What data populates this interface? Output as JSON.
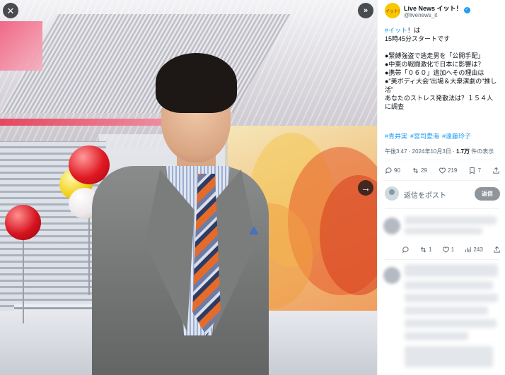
{
  "viewer": {
    "close_icon": "close-icon",
    "expand_icon": "expand-right-icon",
    "next_icon": "arrow-right-icon"
  },
  "tweet": {
    "author_name": "Live News イット！",
    "author_handle": "@livenews_it",
    "avatar_text": "イット!",
    "text_lines": [
      {
        "hashtag": "#イット",
        "rest": "！は"
      },
      {
        "hashtag": "",
        "rest": "15時45分スタートです"
      },
      {
        "hashtag": "",
        "rest": ""
      },
      {
        "hashtag": "",
        "rest": "●緊縛強盗で逃走男を「公開手配」"
      },
      {
        "hashtag": "",
        "rest": "●中東の戦闘激化で日本に影響は？"
      },
      {
        "hashtag": "",
        "rest": "●携帯「０６０」追加へその理由は"
      },
      {
        "hashtag": "",
        "rest": "●\"美ボディ大会\"出場＆大衆演劇の\"推し"
      },
      {
        "hashtag": "",
        "rest": "活\""
      },
      {
        "hashtag": "",
        "rest": "あなたのストレス発散法は？１５４人"
      },
      {
        "hashtag": "",
        "rest": "に調査"
      }
    ],
    "hashtags": [
      "#青井実",
      "#宮司愛海",
      "#遠藤玲子"
    ],
    "meta_time": "午後3:47 · 2024年10月3日 · ",
    "meta_views": "1.7万",
    "meta_views_suffix": " 件の表示",
    "actions": {
      "replies": "90",
      "retweets": "29",
      "likes": "219",
      "bookmarks": "7"
    },
    "reply_placeholder": "返信をポスト",
    "reply_button": "返信"
  },
  "reply1": {
    "actions": {
      "replies": "",
      "retweets": "1",
      "likes": "1",
      "views": "243"
    }
  },
  "colors": {
    "accent": "#1d9bf0",
    "text": "#0f1419",
    "secondary": "#536471"
  }
}
